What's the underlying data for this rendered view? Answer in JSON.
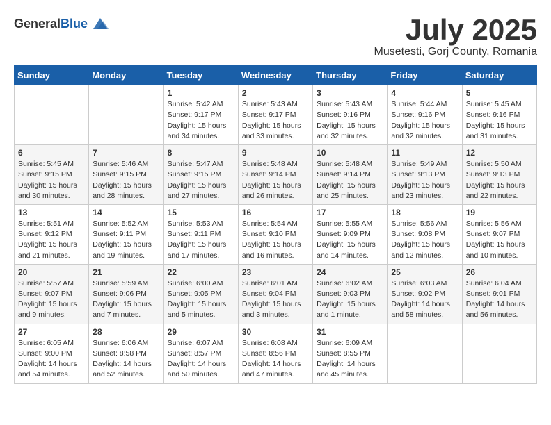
{
  "logo": {
    "general": "General",
    "blue": "Blue"
  },
  "title": {
    "month": "July 2025",
    "location": "Musetesti, Gorj County, Romania"
  },
  "headers": [
    "Sunday",
    "Monday",
    "Tuesday",
    "Wednesday",
    "Thursday",
    "Friday",
    "Saturday"
  ],
  "weeks": [
    [
      {
        "day": "",
        "info": ""
      },
      {
        "day": "",
        "info": ""
      },
      {
        "day": "1",
        "info": "Sunrise: 5:42 AM\nSunset: 9:17 PM\nDaylight: 15 hours and 34 minutes."
      },
      {
        "day": "2",
        "info": "Sunrise: 5:43 AM\nSunset: 9:17 PM\nDaylight: 15 hours and 33 minutes."
      },
      {
        "day": "3",
        "info": "Sunrise: 5:43 AM\nSunset: 9:16 PM\nDaylight: 15 hours and 32 minutes."
      },
      {
        "day": "4",
        "info": "Sunrise: 5:44 AM\nSunset: 9:16 PM\nDaylight: 15 hours and 32 minutes."
      },
      {
        "day": "5",
        "info": "Sunrise: 5:45 AM\nSunset: 9:16 PM\nDaylight: 15 hours and 31 minutes."
      }
    ],
    [
      {
        "day": "6",
        "info": "Sunrise: 5:45 AM\nSunset: 9:15 PM\nDaylight: 15 hours and 30 minutes."
      },
      {
        "day": "7",
        "info": "Sunrise: 5:46 AM\nSunset: 9:15 PM\nDaylight: 15 hours and 28 minutes."
      },
      {
        "day": "8",
        "info": "Sunrise: 5:47 AM\nSunset: 9:15 PM\nDaylight: 15 hours and 27 minutes."
      },
      {
        "day": "9",
        "info": "Sunrise: 5:48 AM\nSunset: 9:14 PM\nDaylight: 15 hours and 26 minutes."
      },
      {
        "day": "10",
        "info": "Sunrise: 5:48 AM\nSunset: 9:14 PM\nDaylight: 15 hours and 25 minutes."
      },
      {
        "day": "11",
        "info": "Sunrise: 5:49 AM\nSunset: 9:13 PM\nDaylight: 15 hours and 23 minutes."
      },
      {
        "day": "12",
        "info": "Sunrise: 5:50 AM\nSunset: 9:13 PM\nDaylight: 15 hours and 22 minutes."
      }
    ],
    [
      {
        "day": "13",
        "info": "Sunrise: 5:51 AM\nSunset: 9:12 PM\nDaylight: 15 hours and 21 minutes."
      },
      {
        "day": "14",
        "info": "Sunrise: 5:52 AM\nSunset: 9:11 PM\nDaylight: 15 hours and 19 minutes."
      },
      {
        "day": "15",
        "info": "Sunrise: 5:53 AM\nSunset: 9:11 PM\nDaylight: 15 hours and 17 minutes."
      },
      {
        "day": "16",
        "info": "Sunrise: 5:54 AM\nSunset: 9:10 PM\nDaylight: 15 hours and 16 minutes."
      },
      {
        "day": "17",
        "info": "Sunrise: 5:55 AM\nSunset: 9:09 PM\nDaylight: 15 hours and 14 minutes."
      },
      {
        "day": "18",
        "info": "Sunrise: 5:56 AM\nSunset: 9:08 PM\nDaylight: 15 hours and 12 minutes."
      },
      {
        "day": "19",
        "info": "Sunrise: 5:56 AM\nSunset: 9:07 PM\nDaylight: 15 hours and 10 minutes."
      }
    ],
    [
      {
        "day": "20",
        "info": "Sunrise: 5:57 AM\nSunset: 9:07 PM\nDaylight: 15 hours and 9 minutes."
      },
      {
        "day": "21",
        "info": "Sunrise: 5:59 AM\nSunset: 9:06 PM\nDaylight: 15 hours and 7 minutes."
      },
      {
        "day": "22",
        "info": "Sunrise: 6:00 AM\nSunset: 9:05 PM\nDaylight: 15 hours and 5 minutes."
      },
      {
        "day": "23",
        "info": "Sunrise: 6:01 AM\nSunset: 9:04 PM\nDaylight: 15 hours and 3 minutes."
      },
      {
        "day": "24",
        "info": "Sunrise: 6:02 AM\nSunset: 9:03 PM\nDaylight: 15 hours and 1 minute."
      },
      {
        "day": "25",
        "info": "Sunrise: 6:03 AM\nSunset: 9:02 PM\nDaylight: 14 hours and 58 minutes."
      },
      {
        "day": "26",
        "info": "Sunrise: 6:04 AM\nSunset: 9:01 PM\nDaylight: 14 hours and 56 minutes."
      }
    ],
    [
      {
        "day": "27",
        "info": "Sunrise: 6:05 AM\nSunset: 9:00 PM\nDaylight: 14 hours and 54 minutes."
      },
      {
        "day": "28",
        "info": "Sunrise: 6:06 AM\nSunset: 8:58 PM\nDaylight: 14 hours and 52 minutes."
      },
      {
        "day": "29",
        "info": "Sunrise: 6:07 AM\nSunset: 8:57 PM\nDaylight: 14 hours and 50 minutes."
      },
      {
        "day": "30",
        "info": "Sunrise: 6:08 AM\nSunset: 8:56 PM\nDaylight: 14 hours and 47 minutes."
      },
      {
        "day": "31",
        "info": "Sunrise: 6:09 AM\nSunset: 8:55 PM\nDaylight: 14 hours and 45 minutes."
      },
      {
        "day": "",
        "info": ""
      },
      {
        "day": "",
        "info": ""
      }
    ]
  ]
}
